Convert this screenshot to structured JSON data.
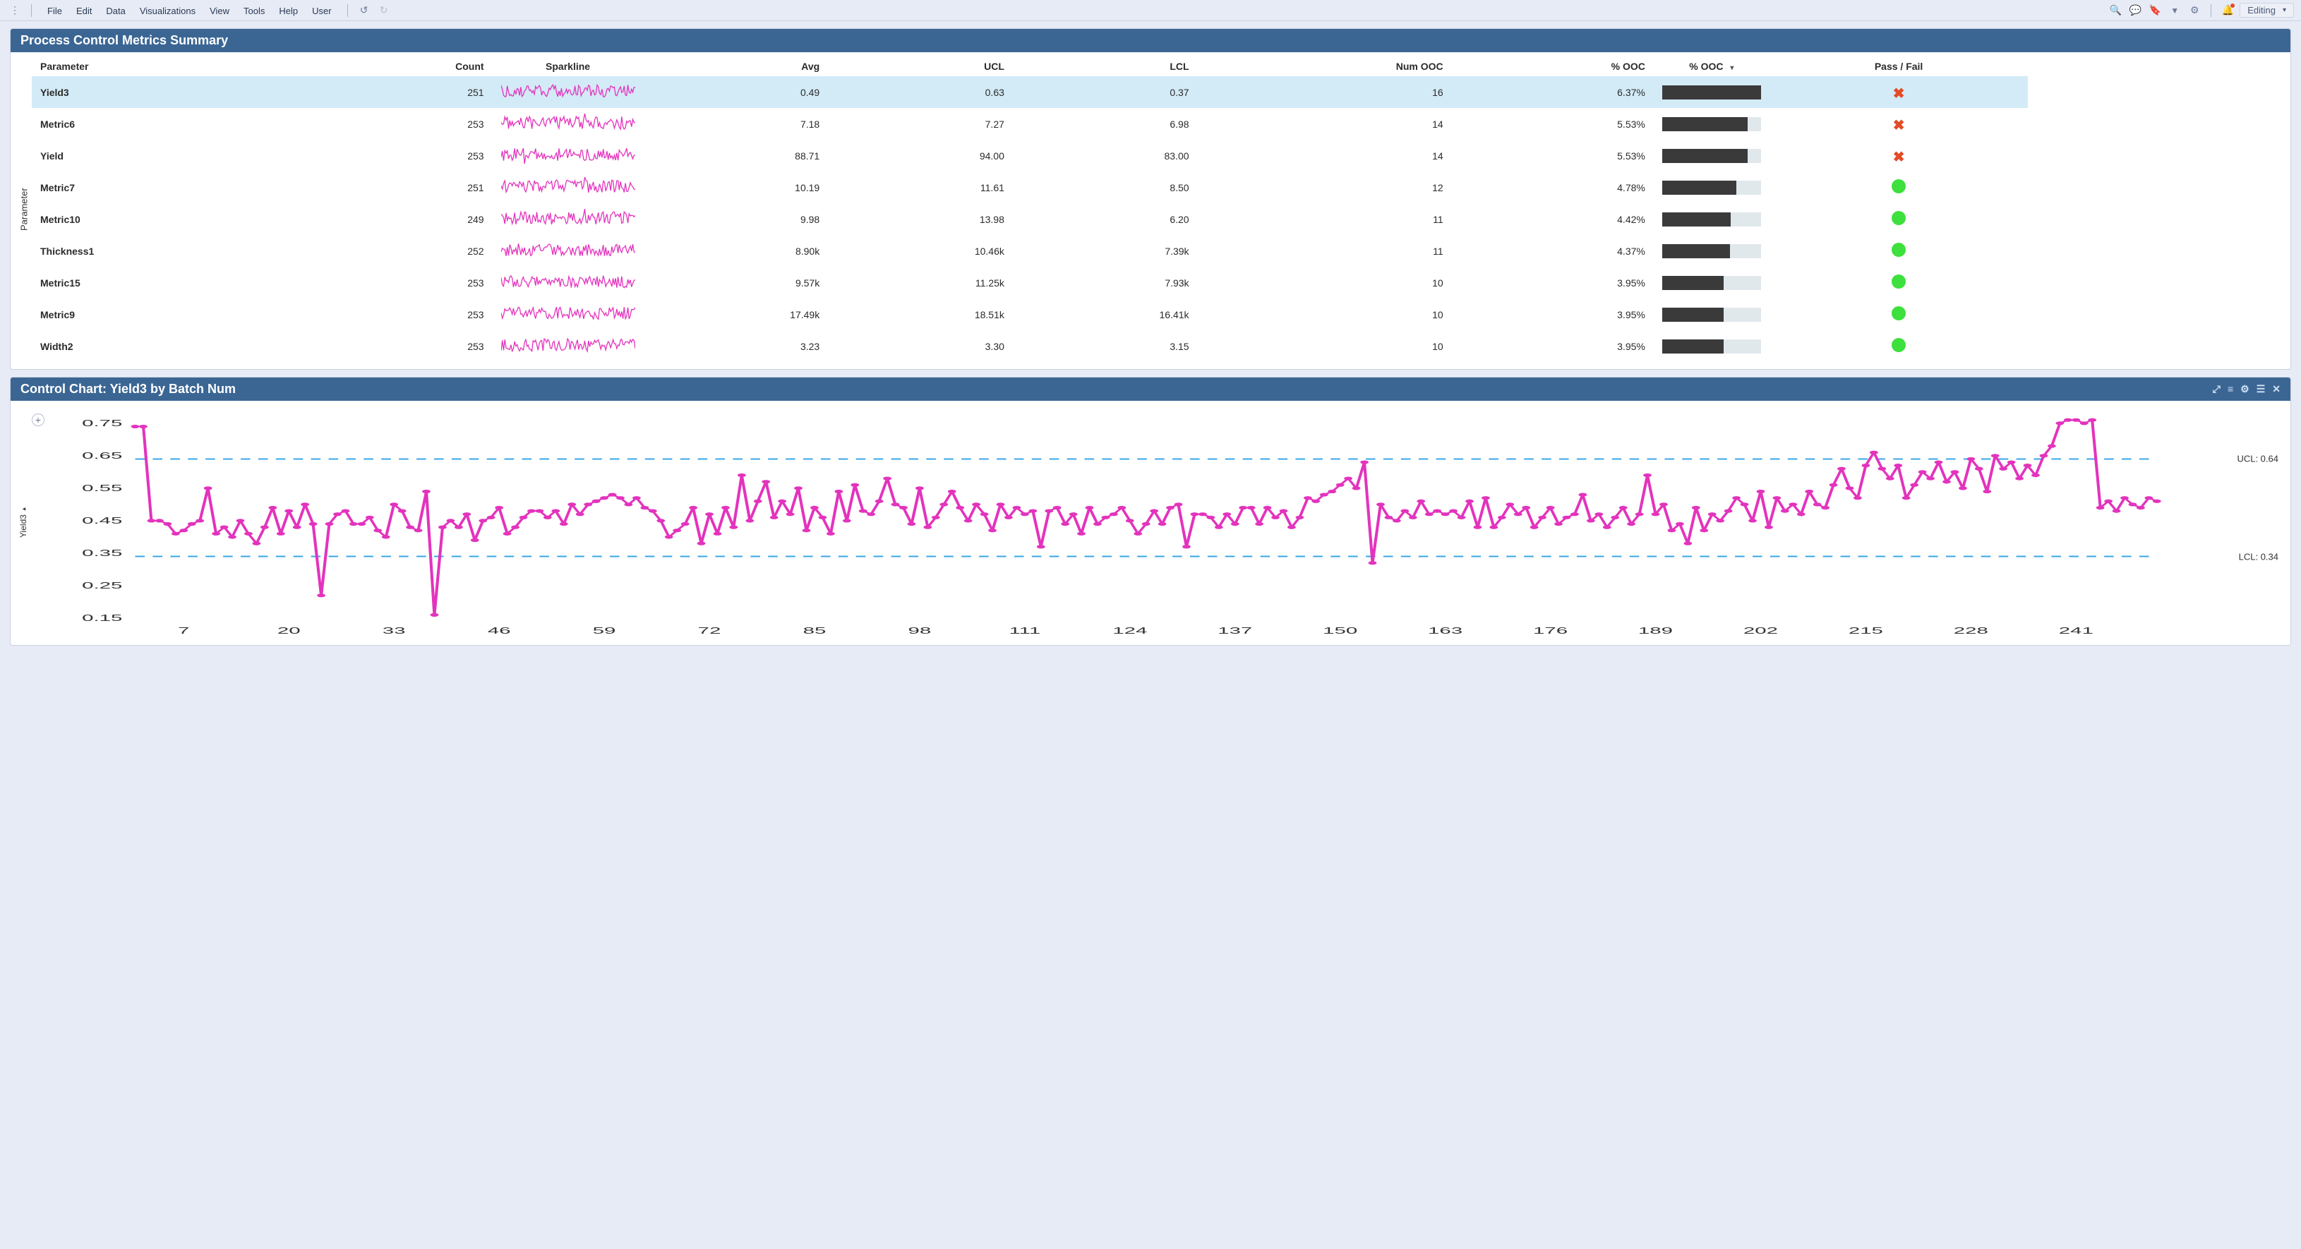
{
  "toolbar": {
    "menus": [
      "File",
      "Edit",
      "Data",
      "Visualizations",
      "View",
      "Tools",
      "Help",
      "User"
    ],
    "mode_label": "Editing"
  },
  "panel1": {
    "title": "Process Control Metrics Summary",
    "y_axis_label": "Parameter",
    "columns": {
      "parameter": "Parameter",
      "count": "Count",
      "sparkline": "Sparkline",
      "avg": "Avg",
      "ucl": "UCL",
      "lcl": "LCL",
      "num_ooc": "Num OOC",
      "pct_ooc": "% OOC",
      "pct_ooc_bar": "% OOC",
      "pass_fail": "Pass / Fail"
    },
    "bar_max_pct": 6.37,
    "rows": [
      {
        "parameter": "Yield3",
        "count": 251,
        "avg": "0.49",
        "ucl": "0.63",
        "lcl": "0.37",
        "num_ooc": 16,
        "pct_ooc": "6.37%",
        "pct_val": 6.37,
        "pass": "fail",
        "selected": true
      },
      {
        "parameter": "Metric6",
        "count": 253,
        "avg": "7.18",
        "ucl": "7.27",
        "lcl": "6.98",
        "num_ooc": 14,
        "pct_ooc": "5.53%",
        "pct_val": 5.53,
        "pass": "fail",
        "selected": false
      },
      {
        "parameter": "Yield",
        "count": 253,
        "avg": "88.71",
        "ucl": "94.00",
        "lcl": "83.00",
        "num_ooc": 14,
        "pct_ooc": "5.53%",
        "pct_val": 5.53,
        "pass": "fail",
        "selected": false
      },
      {
        "parameter": "Metric7",
        "count": 251,
        "avg": "10.19",
        "ucl": "11.61",
        "lcl": "8.50",
        "num_ooc": 12,
        "pct_ooc": "4.78%",
        "pct_val": 4.78,
        "pass": "pass",
        "selected": false
      },
      {
        "parameter": "Metric10",
        "count": 249,
        "avg": "9.98",
        "ucl": "13.98",
        "lcl": "6.20",
        "num_ooc": 11,
        "pct_ooc": "4.42%",
        "pct_val": 4.42,
        "pass": "pass",
        "selected": false
      },
      {
        "parameter": "Thickness1",
        "count": 252,
        "avg": "8.90k",
        "ucl": "10.46k",
        "lcl": "7.39k",
        "num_ooc": 11,
        "pct_ooc": "4.37%",
        "pct_val": 4.37,
        "pass": "pass",
        "selected": false
      },
      {
        "parameter": "Metric15",
        "count": 253,
        "avg": "9.57k",
        "ucl": "11.25k",
        "lcl": "7.93k",
        "num_ooc": 10,
        "pct_ooc": "3.95%",
        "pct_val": 3.95,
        "pass": "pass",
        "selected": false
      },
      {
        "parameter": "Metric9",
        "count": 253,
        "avg": "17.49k",
        "ucl": "18.51k",
        "lcl": "16.41k",
        "num_ooc": 10,
        "pct_ooc": "3.95%",
        "pct_val": 3.95,
        "pass": "pass",
        "selected": false
      },
      {
        "parameter": "Width2",
        "count": 253,
        "avg": "3.23",
        "ucl": "3.30",
        "lcl": "3.15",
        "num_ooc": 10,
        "pct_ooc": "3.95%",
        "pct_val": 3.95,
        "pass": "pass",
        "selected": false
      }
    ]
  },
  "panel2": {
    "title": "Control Chart: Yield3 by Batch Num",
    "y_axis_name": "Yield3",
    "ucl_label": "UCL: 0.64",
    "lcl_label": "LCL: 0.34"
  },
  "chart_data": {
    "type": "line",
    "title": "Control Chart: Yield3 by Batch Num",
    "xlabel": "Batch Num",
    "ylabel": "Yield3",
    "ylim": [
      0.15,
      0.78
    ],
    "y_ticks": [
      0.15,
      0.25,
      0.35,
      0.45,
      0.55,
      0.65,
      0.75
    ],
    "x_ticks": [
      7,
      20,
      33,
      46,
      59,
      72,
      85,
      98,
      111,
      124,
      137,
      150,
      163,
      176,
      189,
      202,
      215,
      228,
      241
    ],
    "ucl": 0.64,
    "lcl": 0.34,
    "x_range": [
      1,
      251
    ],
    "series": [
      {
        "name": "Yield3",
        "color": "#e333bd",
        "values": [
          0.74,
          0.74,
          0.45,
          0.45,
          0.44,
          0.41,
          0.42,
          0.44,
          0.45,
          0.55,
          0.41,
          0.43,
          0.4,
          0.45,
          0.41,
          0.38,
          0.43,
          0.49,
          0.41,
          0.48,
          0.43,
          0.5,
          0.44,
          0.22,
          0.44,
          0.47,
          0.48,
          0.44,
          0.44,
          0.46,
          0.42,
          0.4,
          0.5,
          0.48,
          0.43,
          0.42,
          0.54,
          0.16,
          0.43,
          0.45,
          0.43,
          0.47,
          0.39,
          0.45,
          0.46,
          0.49,
          0.41,
          0.43,
          0.46,
          0.48,
          0.48,
          0.46,
          0.48,
          0.44,
          0.5,
          0.47,
          0.5,
          0.51,
          0.52,
          0.53,
          0.52,
          0.5,
          0.52,
          0.49,
          0.48,
          0.45,
          0.4,
          0.42,
          0.44,
          0.49,
          0.38,
          0.47,
          0.41,
          0.49,
          0.43,
          0.59,
          0.45,
          0.51,
          0.57,
          0.46,
          0.51,
          0.47,
          0.55,
          0.42,
          0.49,
          0.46,
          0.41,
          0.54,
          0.45,
          0.56,
          0.48,
          0.47,
          0.51,
          0.58,
          0.5,
          0.49,
          0.44,
          0.55,
          0.43,
          0.46,
          0.5,
          0.54,
          0.49,
          0.45,
          0.5,
          0.47,
          0.42,
          0.5,
          0.46,
          0.49,
          0.47,
          0.48,
          0.37,
          0.48,
          0.49,
          0.44,
          0.47,
          0.41,
          0.49,
          0.44,
          0.46,
          0.47,
          0.49,
          0.45,
          0.41,
          0.44,
          0.48,
          0.44,
          0.49,
          0.5,
          0.37,
          0.47,
          0.47,
          0.46,
          0.43,
          0.47,
          0.44,
          0.49,
          0.49,
          0.44,
          0.49,
          0.46,
          0.48,
          0.43,
          0.46,
          0.52,
          0.51,
          0.53,
          0.54,
          0.56,
          0.58,
          0.55,
          0.63,
          0.32,
          0.5,
          0.46,
          0.45,
          0.48,
          0.46,
          0.51,
          0.47,
          0.48,
          0.47,
          0.48,
          0.46,
          0.51,
          0.43,
          0.52,
          0.43,
          0.46,
          0.5,
          0.47,
          0.49,
          0.43,
          0.46,
          0.49,
          0.44,
          0.46,
          0.47,
          0.53,
          0.45,
          0.47,
          0.43,
          0.46,
          0.49,
          0.44,
          0.47,
          0.59,
          0.47,
          0.5,
          0.42,
          0.44,
          0.38,
          0.49,
          0.42,
          0.47,
          0.45,
          0.48,
          0.52,
          0.5,
          0.45,
          0.54,
          0.43,
          0.52,
          0.48,
          0.5,
          0.47,
          0.54,
          0.5,
          0.49,
          0.56,
          0.61,
          0.55,
          0.52,
          0.62,
          0.66,
          0.61,
          0.58,
          0.62,
          0.52,
          0.56,
          0.6,
          0.58,
          0.63,
          0.57,
          0.6,
          0.55,
          0.64,
          0.61,
          0.54,
          0.65,
          0.61,
          0.63,
          0.58,
          0.62,
          0.59,
          0.65,
          0.68,
          0.75,
          0.76,
          0.76,
          0.75,
          0.76,
          0.49,
          0.51,
          0.48,
          0.52,
          0.5,
          0.49,
          0.52,
          0.51
        ]
      }
    ]
  }
}
